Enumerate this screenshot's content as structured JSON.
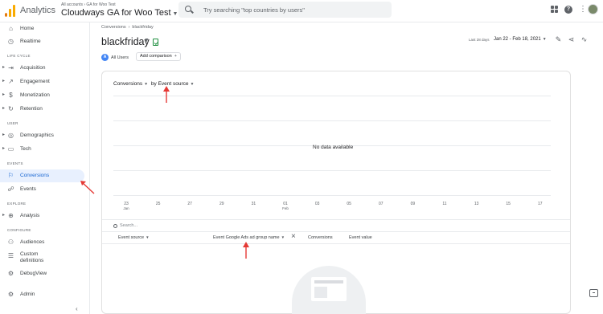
{
  "app": {
    "name": "Analytics"
  },
  "account": {
    "breadcrumb": "All accounts › GA for Woo Test",
    "property": "Cloudways GA for Woo Test"
  },
  "search": {
    "placeholder": "Try searching \"top countries by users\""
  },
  "sidebar": {
    "items": [
      {
        "label": "Home",
        "icon": "home-icon"
      },
      {
        "label": "Realtime",
        "icon": "clock-icon"
      }
    ],
    "lifecycle_label": "LIFE CYCLE",
    "lifecycle": [
      {
        "label": "Acquisition",
        "icon": "acquisition-icon"
      },
      {
        "label": "Engagement",
        "icon": "engagement-icon"
      },
      {
        "label": "Monetization",
        "icon": "monetization-icon"
      },
      {
        "label": "Retention",
        "icon": "retention-icon"
      }
    ],
    "user_label": "USER",
    "user": [
      {
        "label": "Demographics",
        "icon": "globe-icon"
      },
      {
        "label": "Tech",
        "icon": "tech-icon"
      }
    ],
    "events_label": "EVENTS",
    "events": [
      {
        "label": "Conversions",
        "icon": "flag-icon",
        "active": true
      },
      {
        "label": "Events",
        "icon": "events-icon"
      }
    ],
    "explore_label": "EXPLORE",
    "explore": [
      {
        "label": "Analysis",
        "icon": "analysis-icon"
      }
    ],
    "configure_label": "CONFIGURE",
    "configure": [
      {
        "label": "Audiences",
        "icon": "audiences-icon"
      },
      {
        "label": "Custom",
        "label2": "definitions",
        "icon": "custom-definitions-icon"
      },
      {
        "label": "DebugView",
        "icon": "debug-icon"
      }
    ],
    "admin": {
      "label": "Admin",
      "icon": "gear-icon"
    }
  },
  "page": {
    "breadcrumb_parent": "Conversions",
    "breadcrumb_current": "blackfriday",
    "title": "blackfriday",
    "date_small": "Last 28 days",
    "date_range": "Jan 22 - Feb 18, 2021"
  },
  "chips": {
    "all_users_letter": "A",
    "all_users": "All Users",
    "add_comparison": "Add comparison"
  },
  "card": {
    "metric": "Conversions",
    "dimension": "by Event source",
    "no_data": "No data available",
    "x_ticks": [
      {
        "label": "23",
        "sub": "Jan"
      },
      {
        "label": "25",
        "sub": ""
      },
      {
        "label": "27",
        "sub": ""
      },
      {
        "label": "29",
        "sub": ""
      },
      {
        "label": "31",
        "sub": ""
      },
      {
        "label": "01",
        "sub": "Feb"
      },
      {
        "label": "03",
        "sub": ""
      },
      {
        "label": "05",
        "sub": ""
      },
      {
        "label": "07",
        "sub": ""
      },
      {
        "label": "09",
        "sub": ""
      },
      {
        "label": "11",
        "sub": ""
      },
      {
        "label": "13",
        "sub": ""
      },
      {
        "label": "15",
        "sub": ""
      },
      {
        "label": "17",
        "sub": ""
      }
    ],
    "table_search": "Search...",
    "columns": {
      "event_source": "Event source",
      "ad_group": "Event Google Ads ad group name",
      "conversions": "Conversions",
      "event_value": "Event value"
    }
  }
}
